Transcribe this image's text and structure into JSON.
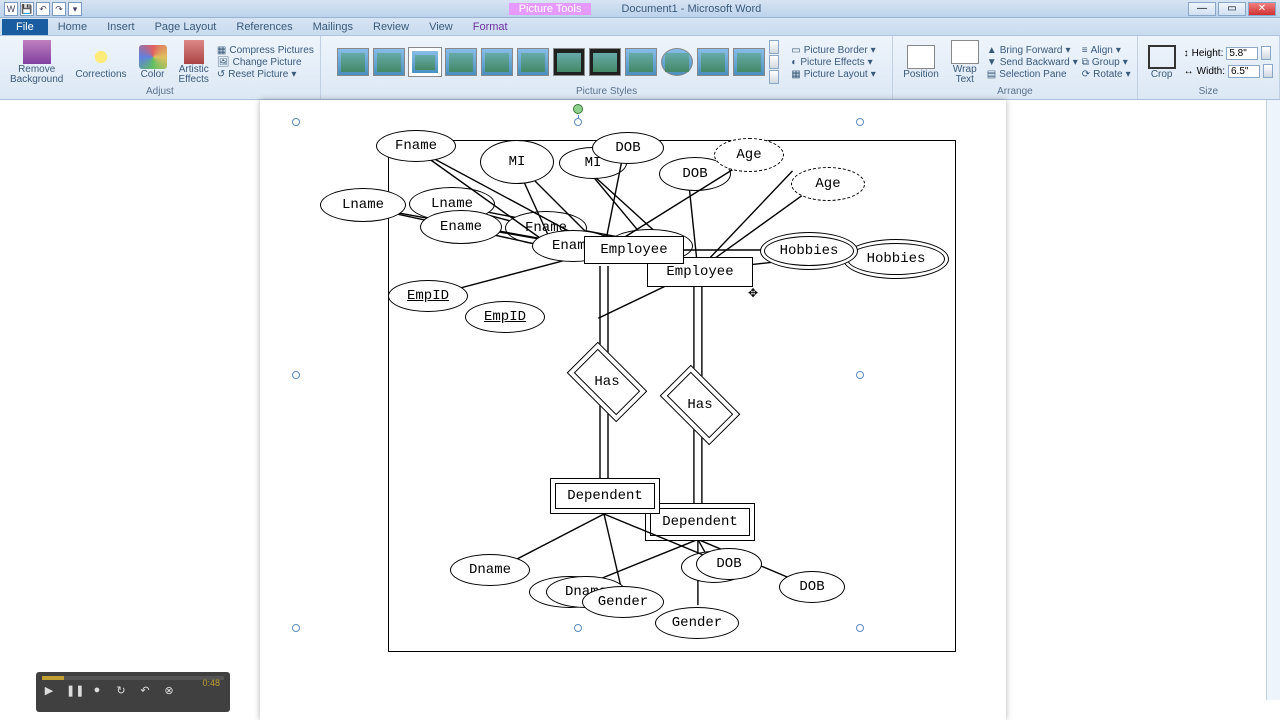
{
  "titlebar": {
    "context_label": "Picture Tools",
    "doc_title": "Document1 - Microsoft Word"
  },
  "tabs": {
    "file": "File",
    "home": "Home",
    "insert": "Insert",
    "page_layout": "Page Layout",
    "references": "References",
    "mailings": "Mailings",
    "review": "Review",
    "view": "View",
    "format": "Format"
  },
  "ribbon": {
    "remove_bg": "Remove\nBackground",
    "corrections": "Corrections",
    "color": "Color",
    "artistic": "Artistic\nEffects",
    "compress": "Compress Pictures",
    "change": "Change Picture",
    "reset": "Reset Picture",
    "adjust_label": "Adjust",
    "styles_label": "Picture Styles",
    "border": "Picture Border",
    "effects": "Picture Effects",
    "layout": "Picture Layout",
    "position": "Position",
    "wrap": "Wrap\nText",
    "bring_fwd": "Bring Forward",
    "send_back": "Send Backward",
    "sel_pane": "Selection Pane",
    "align": "Align",
    "group": "Group",
    "rotate": "Rotate",
    "arrange_label": "Arrange",
    "crop": "Crop",
    "height_label": "Height:",
    "height_val": "5.8\"",
    "width_label": "Width:",
    "width_val": "6.5\"",
    "size_label": "Size"
  },
  "erd": {
    "fname": "Fname",
    "mi": "MI",
    "dob": "DOB",
    "age": "Age",
    "lname": "Lname",
    "ename": "Ename",
    "employee": "Employee",
    "hobbies": "Hobbies",
    "empid": "EmpID",
    "has": "Has",
    "dependent": "Dependent",
    "dname": "Dname",
    "gender": "Gender",
    "e_name_sm": "Ename",
    "mi_fname": "Fname"
  },
  "playback": {
    "time": "0:48"
  }
}
